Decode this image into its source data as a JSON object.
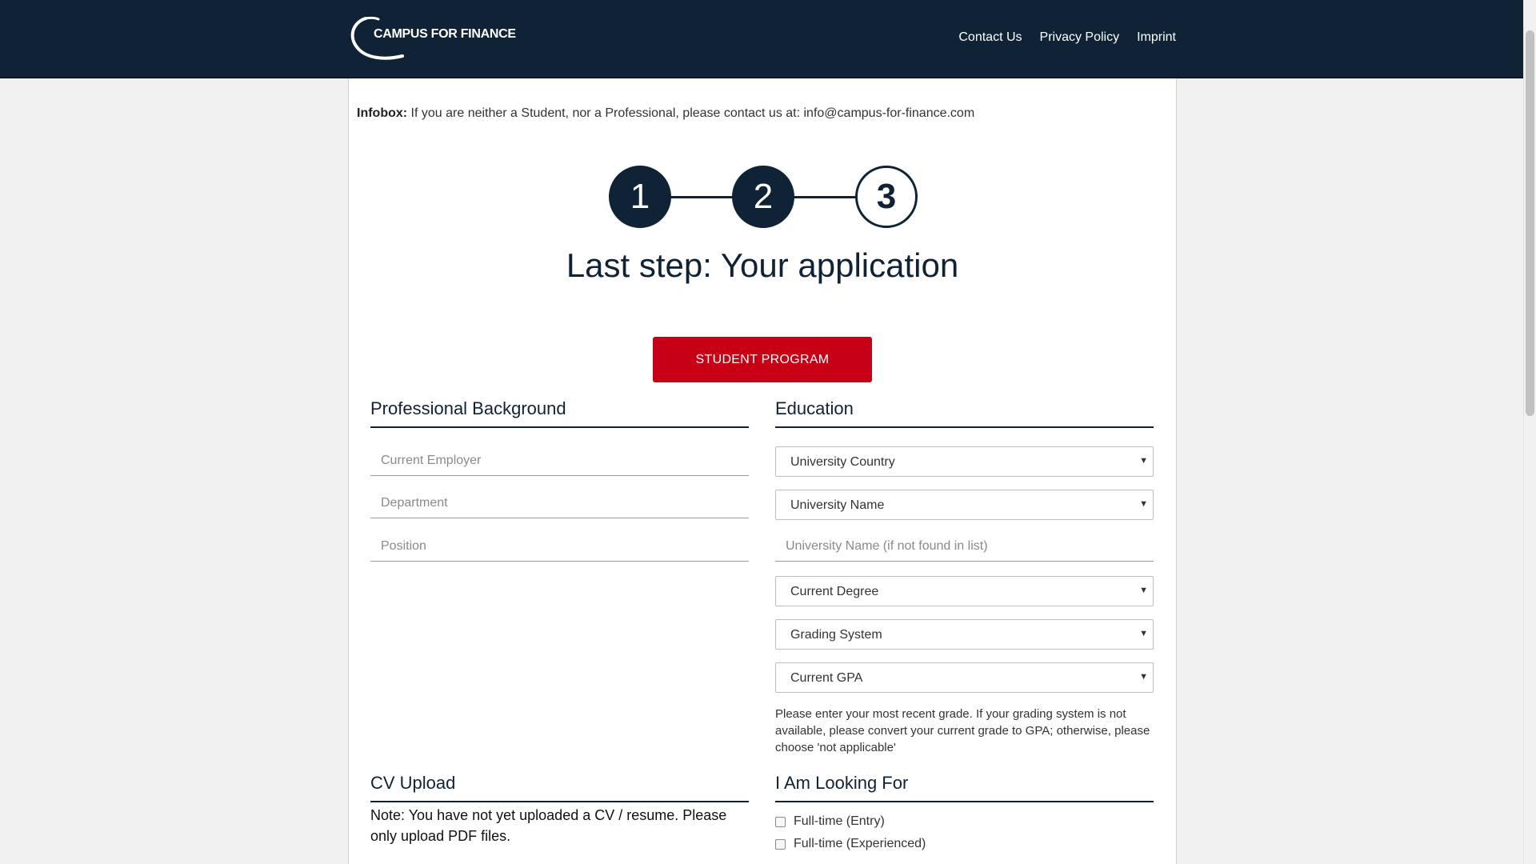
{
  "header": {
    "logo_text": "CAMPUS FOR FINANCE",
    "nav": [
      "Contact Us",
      "Privacy Policy",
      "Imprint"
    ]
  },
  "infobox": {
    "label": "Infobox:",
    "text": " If you are neither a Student, nor a Professional, please contact us at: info@campus-for-finance.com"
  },
  "steps": [
    "1",
    "2",
    "3"
  ],
  "title": "Last step: Your application",
  "program_button": "STUDENT PROGRAM",
  "professional": {
    "title": "Professional Background",
    "fields": [
      {
        "placeholder": "Current Employer"
      },
      {
        "placeholder": "Department"
      },
      {
        "placeholder": "Position"
      }
    ]
  },
  "education": {
    "title": "Education",
    "university_country": "University Country",
    "university_name": "University Name",
    "university_name_other_placeholder": "University Name (if not found in list)",
    "current_degree": "Current Degree",
    "grading_system": "Grading System",
    "current_gpa": "Current GPA",
    "help": "Please enter your most recent grade. If your grading system is not available, please convert your current grade to GPA; otherwise, please choose 'not applicable'"
  },
  "cv": {
    "title": "CV Upload",
    "note": "Note: You have not yet uploaded a CV / resume. Please only upload PDF files."
  },
  "looking_for": {
    "title": "I Am Looking For",
    "options": [
      "Full-time (Entry)",
      "Full-time (Experienced)"
    ]
  },
  "colors": {
    "navy": "#0f2236",
    "accent_red": "#c70015"
  }
}
